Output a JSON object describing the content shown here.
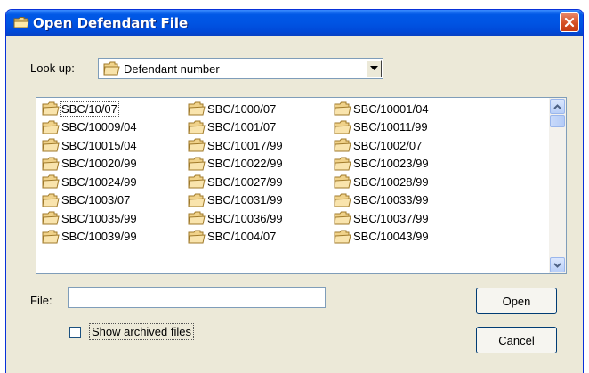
{
  "window": {
    "title": "Open Defendant File",
    "close_icon": "close-icon"
  },
  "lookup": {
    "label": "Look up:",
    "value": "Defendant number"
  },
  "files": [
    "SBC/10/07",
    "SBC/10009/04",
    "SBC/10015/04",
    "SBC/10020/99",
    "SBC/10024/99",
    "SBC/1003/07",
    "SBC/10035/99",
    "SBC/10039/99",
    "SBC/1000/07",
    "SBC/1001/07",
    "SBC/10017/99",
    "SBC/10022/99",
    "SBC/10027/99",
    "SBC/10031/99",
    "SBC/10036/99",
    "SBC/1004/07",
    "SBC/10001/04",
    "SBC/10011/99",
    "SBC/1002/07",
    "SBC/10023/99",
    "SBC/10028/99",
    "SBC/10033/99",
    "SBC/10037/99",
    "SBC/10043/99"
  ],
  "file_field": {
    "label": "File:",
    "value": ""
  },
  "buttons": {
    "open": "Open",
    "cancel": "Cancel"
  },
  "archived": {
    "label": "Show archived files",
    "checked": false
  },
  "colors": {
    "titlebar": "#0054e3",
    "face": "#ece9d8",
    "close": "#d44f24"
  }
}
